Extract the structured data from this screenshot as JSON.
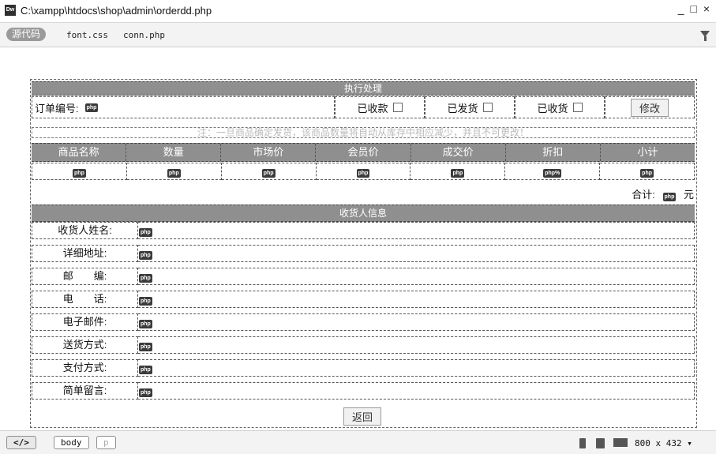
{
  "window": {
    "title": "C:\\xampp\\htdocs\\shop\\admin\\orderdd.php",
    "controls": "_ □ ×"
  },
  "toolbar": {
    "source_label": "源代码",
    "files": [
      "font.css",
      "conn.php"
    ]
  },
  "order": {
    "exec_header": "执行处理",
    "order_no_label": "订单编号:",
    "php_tag": "php",
    "paid_label": "已收款",
    "shipped_label": "已发货",
    "received_label": "已收货",
    "modify_button": "修改",
    "notice": "注：一旦商品确定发货，该商品数量将自动从库存中相应减少，并且不可更改！",
    "columns": [
      "商品名称",
      "数量",
      "市场价",
      "会员价",
      "成交价",
      "折扣",
      "小计"
    ],
    "row_cells": [
      "php",
      "php",
      "php",
      "php",
      "php",
      "php%",
      "php"
    ],
    "total_label": "合计:",
    "total_unit": "元"
  },
  "recipient": {
    "header": "收货人信息",
    "fields": [
      "收货人姓名:",
      "详细地址:",
      "邮　　编:",
      "电　　话:",
      "电子邮件:",
      "送货方式:",
      "支付方式:",
      "简单留言:"
    ]
  },
  "back_button": "返回",
  "status": {
    "code_tag": "</>",
    "body_tag": "body",
    "p_tag": "p",
    "size": "800 x 432"
  }
}
